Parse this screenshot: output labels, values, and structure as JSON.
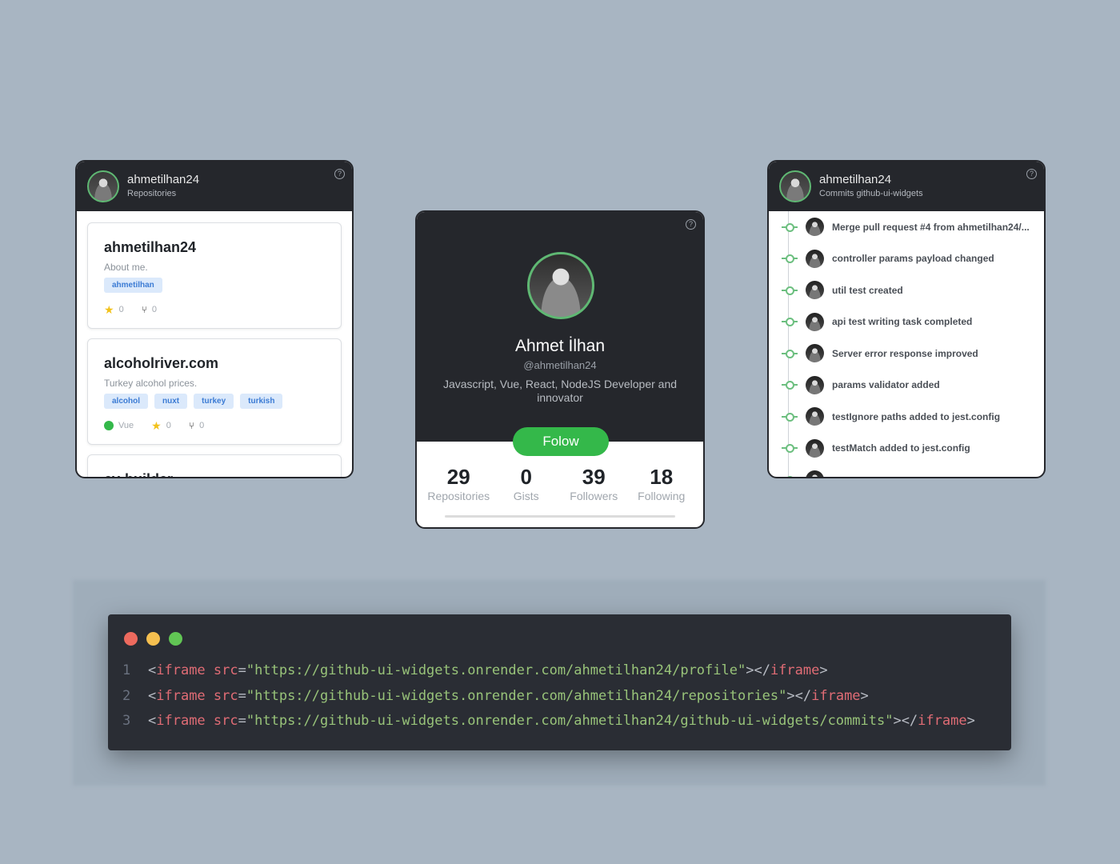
{
  "colors": {
    "background": "#a8b5c2",
    "widget_dark": "#25272c",
    "accent_green": "#34b84a",
    "tag_bg": "#dbe9fb",
    "tag_text": "#3b7bd4"
  },
  "repos_widget": {
    "username": "ahmetilhan24",
    "subtitle": "Repositories",
    "help_icon": "question-circle-icon",
    "repos": [
      {
        "name": "ahmetilhan24",
        "description": "About me.",
        "tags": [
          "ahmetilhan"
        ],
        "language": "",
        "stars": "0",
        "forks": "0"
      },
      {
        "name": "alcoholriver.com",
        "description": "Turkey alcohol prices.",
        "tags": [
          "alcohol",
          "nuxt",
          "turkey",
          "turkish"
        ],
        "language": "Vue",
        "stars": "0",
        "forks": "0"
      },
      {
        "name": "cv-builder",
        "description": "",
        "tags": [],
        "language": "",
        "stars": "",
        "forks": ""
      }
    ]
  },
  "profile_widget": {
    "name": "Ahmet İlhan",
    "handle": "@ahmetilhan24",
    "bio": "Javascript, Vue, React, NodeJS Developer and innovator",
    "follow_label": "Folow",
    "stats": [
      {
        "value": "29",
        "label": "Repositories"
      },
      {
        "value": "0",
        "label": "Gists"
      },
      {
        "value": "39",
        "label": "Followers"
      },
      {
        "value": "18",
        "label": "Following"
      }
    ]
  },
  "commits_widget": {
    "username": "ahmetilhan24",
    "subtitle": "Commits github-ui-widgets",
    "commits": [
      "Merge pull request #4 from ahmetilhan24/...",
      "controller params payload changed",
      "util test created",
      "api test writing task completed",
      "Server error response improved",
      "params validator added",
      "testIgnore paths added to jest.config",
      "testMatch added to jest.config"
    ]
  },
  "code_window": {
    "dots": [
      "#ed6a5e",
      "#f5bf4f",
      "#61c554"
    ],
    "lines": [
      {
        "num": "1",
        "open": "<",
        "tag": "iframe",
        "attr": "src",
        "eq": "=",
        "url": "\"https://github-ui-widgets.onrender.com/ahmetilhan24/profile\"",
        "mid": "></",
        "close_tag": "iframe",
        "end": ">"
      },
      {
        "num": "2",
        "open": "<",
        "tag": "iframe",
        "attr": "src",
        "eq": "=",
        "url": "\"https://github-ui-widgets.onrender.com/ahmetilhan24/repositories\"",
        "mid": "></",
        "close_tag": "iframe",
        "end": ">"
      },
      {
        "num": "3",
        "open": "<",
        "tag": "iframe",
        "attr": "src",
        "eq": "=",
        "url": "\"https://github-ui-widgets.onrender.com/ahmetilhan24/github-ui-widgets/commits\"",
        "mid": "></",
        "close_tag": "iframe",
        "end": ">"
      }
    ]
  }
}
